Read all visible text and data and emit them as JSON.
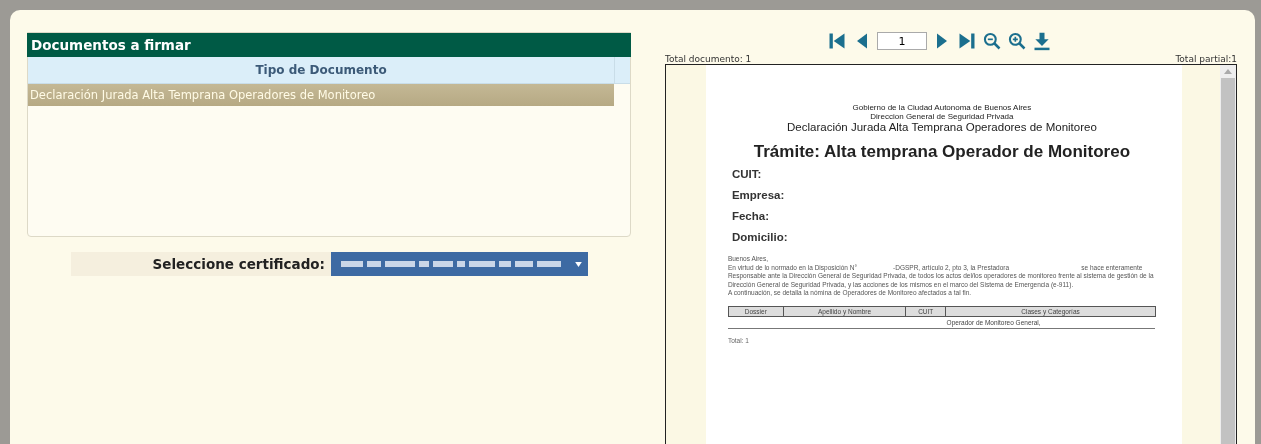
{
  "documents_panel": {
    "title": "Documentos a firmar",
    "columns": [
      "Tipo de Documento"
    ],
    "rows": [
      {
        "label": "Declaración Jurada Alta Temprana Operadores de Monitoreo",
        "selected": true
      }
    ]
  },
  "certificate": {
    "label": "Seleccione certificado:"
  },
  "viewer": {
    "page_number": "1",
    "total_document": "Total documento: 1",
    "total_partial": "Total partial:1",
    "document": {
      "header_lines": [
        "Gobierno de la Ciudad Autonoma de Buenos Aires",
        "Direccion General de Seguridad Privada"
      ],
      "subtitle": "Declaración Jurada Alta Temprana Operadores de Monitoreo",
      "title": "Trámite: Alta temprana Operador de Monitoreo",
      "fields": [
        "CUIT:",
        "Empresa:",
        "Fecha:",
        "Domicilio:"
      ],
      "paragraphs": [
        "Buenos Aires,",
        "En virtud de lo normado en la Disposición N°                    -DGSPR, artículo 2, pto 3, la Prestadora                                        se hace enteramente Responsable ante la Dirección General de Seguridad Privada, de todos los actos del/los operadores de monitoreo frente al sistema de gestión de la Dirección General de Seguridad Privada, y las acciones de los mismos en el marco del Sistema de Emergencia (e-911).",
        "A continuación, se detalla la nómina de Operadores de Monitoreo afectados a tal fin."
      ],
      "table_columns": [
        "Dossier",
        "Apellido y Nombre",
        "CUIT",
        "Clases y Categorías"
      ],
      "table_rows": [
        [
          "",
          "",
          "",
          "Operador de Monitoreo General,"
        ]
      ],
      "total": "Total: 1"
    }
  }
}
